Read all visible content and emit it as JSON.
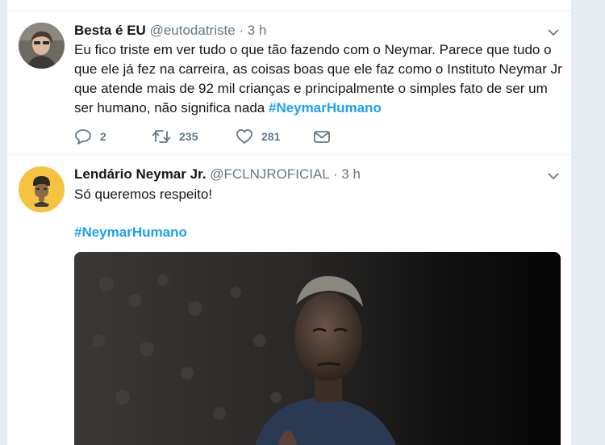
{
  "tweets": [
    {
      "author_name": "Besta é EU",
      "handle": "@eutodatriste",
      "separator": "·",
      "time": "3 h",
      "text_lines": [
        "Eu fico triste em ver tudo o que tão fazendo com o Neymar. Parece que tudo o",
        "que ele já fez na carreira, as coisas boas que ele faz como o Instituto Neymar Jr",
        "que atende mais de 92 mil crianças e principalmente o simples fato de ser um",
        "ser humano, não significa nada"
      ],
      "hashtag": "#NeymarHumano",
      "actions": {
        "reply_count": "2",
        "retweet_count": "235",
        "like_count": "281",
        "reply_icon": "reply-icon",
        "retweet_icon": "retweet-icon",
        "like_icon": "heart-icon",
        "dm_icon": "envelope-icon"
      }
    },
    {
      "author_name": "Lendário Neymar Jr.",
      "handle": "@FCLNJROFICIAL",
      "separator": "·",
      "time": "3 h",
      "text": "Só queremos respeito!",
      "hashtag": "#NeymarHumano",
      "avatar_color": "#f5c242"
    }
  ],
  "colors": {
    "link": "#1da1f2",
    "secondary_text": "#657786",
    "primary_text": "#14171a",
    "divider": "#e6ecf0"
  }
}
